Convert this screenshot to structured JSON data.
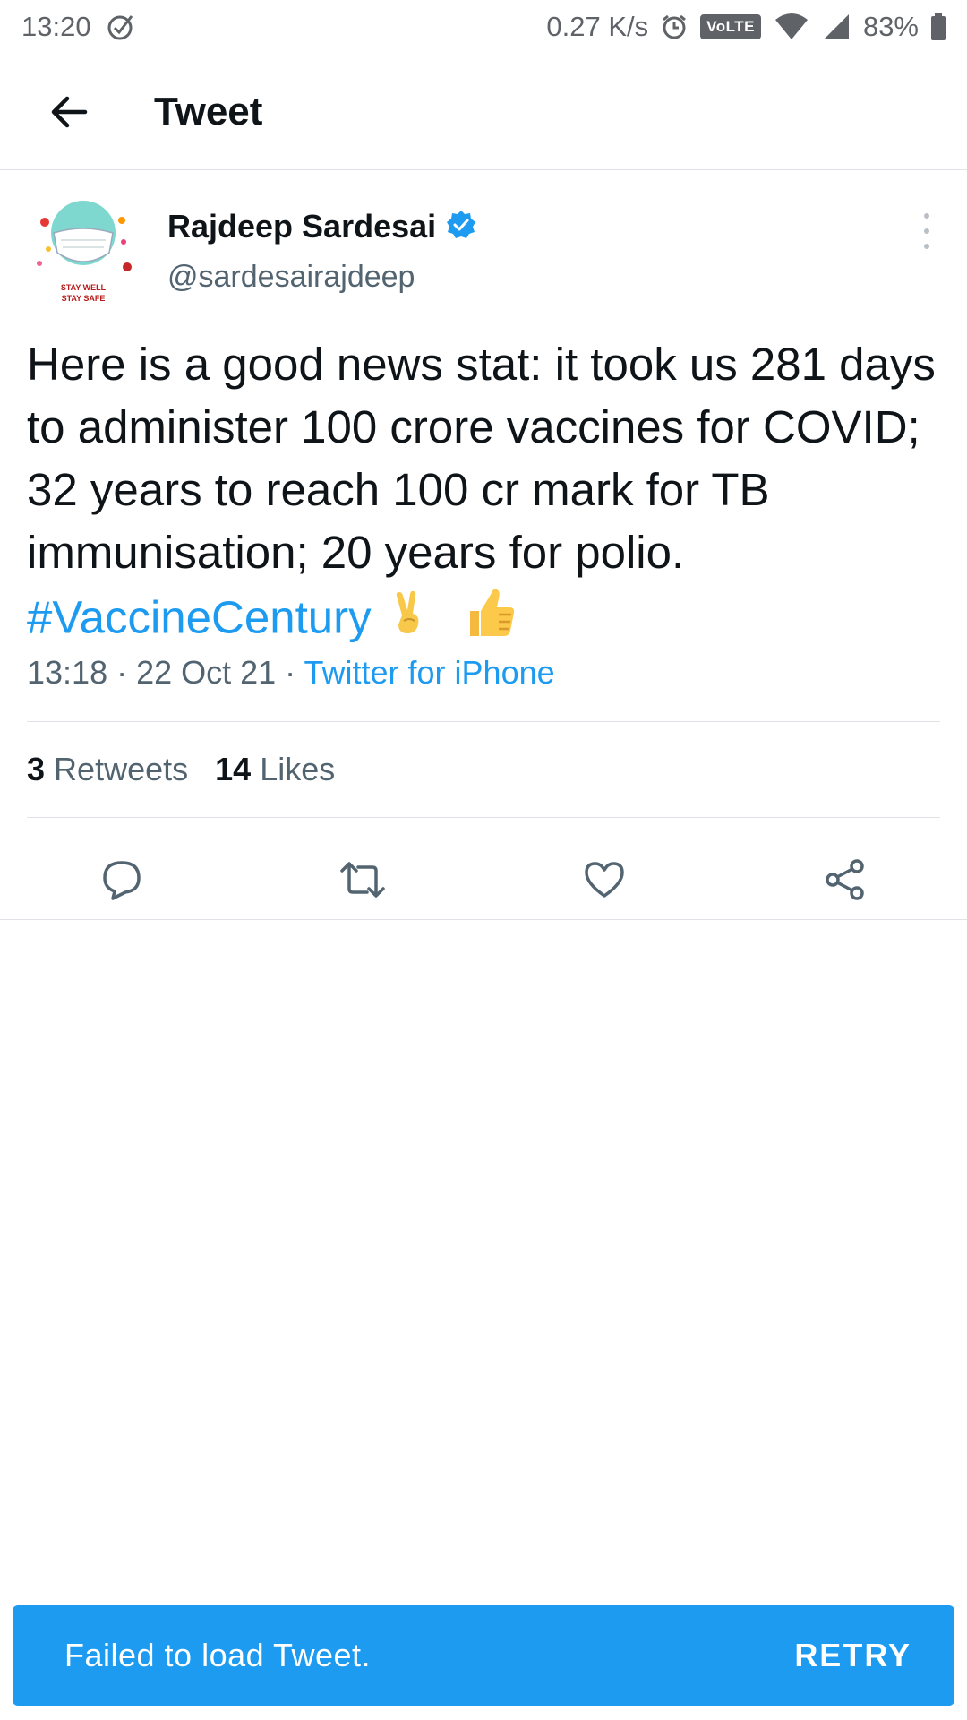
{
  "status_bar": {
    "time": "13:20",
    "net_speed": "0.27 K/s",
    "volte": "VoLTE",
    "battery": "83%"
  },
  "header": {
    "title": "Tweet"
  },
  "author": {
    "name": "Rajdeep Sardesai",
    "handle": "@sardesairajdeep",
    "avatar_text_1": "STAY WELL",
    "avatar_text_2": "STAY SAFE"
  },
  "tweet": {
    "text": "Here is a good news stat: it took us 281 days to administer 100 crore vaccines for COVID; 32 years to reach 100 cr mark for TB immunisation; 20 years for polio.",
    "hashtag": "#VaccineCentury",
    "emojis": [
      "✌",
      "👍"
    ],
    "time": "13:18 · 22 Oct 21 · ",
    "source": "Twitter for iPhone"
  },
  "stats": {
    "retweets_count": "3",
    "retweets_label": "Retweets",
    "likes_count": "14",
    "likes_label": "Likes"
  },
  "actions": [
    "reply-icon",
    "retweet-icon",
    "like-icon",
    "share-icon"
  ],
  "snackbar": {
    "message": "Failed to load Tweet.",
    "action": "RETRY"
  },
  "colors": {
    "accent": "#1d9bf0",
    "text": "#0f1419",
    "secondary": "#536471"
  }
}
